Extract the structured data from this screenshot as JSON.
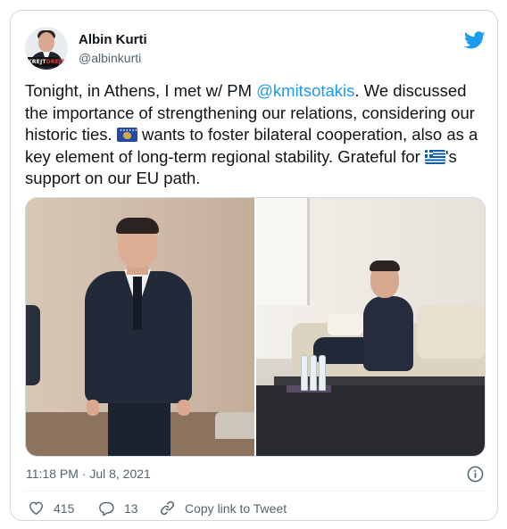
{
  "author": {
    "name": "Albin Kurti",
    "handle": "@albinkurti",
    "avatar_badge_top": "KREJT",
    "avatar_badge_bottom": "DREJT"
  },
  "tweet": {
    "text_1": "Tonight, in Athens, I met w/ PM ",
    "mention": "@kmitsotakis",
    "text_2": ". We discussed the importance of strengthening our relations, considering our historic ties. ",
    "text_3": " wants to foster bilateral cooperation, also as a key element of long-term regional stability. Grateful for ",
    "text_4": "'s support on our EU path.",
    "flag_1": "kosovo-flag-emoji",
    "flag_2": "greece-flag-emoji"
  },
  "media": {
    "left_photo": "standing-portrait-photo",
    "right_photo": "seated-meeting-photo"
  },
  "meta": {
    "timestamp": "11:18 PM · Jul 8, 2021"
  },
  "actions": {
    "like_count": "415",
    "reply_count": "13",
    "copy_label": "Copy link to Tweet"
  },
  "colors": {
    "accent": "#1d9bf0",
    "secondary_text": "#536471",
    "border": "#cfd9de"
  }
}
